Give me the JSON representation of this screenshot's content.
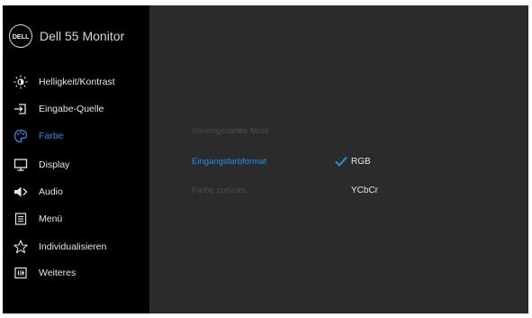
{
  "header": {
    "logo_text": "DELL",
    "model": "Dell 55 Monitor"
  },
  "menu": {
    "items": [
      {
        "label": "Helligkeit/Kontrast",
        "icon": "brightness-icon"
      },
      {
        "label": "Eingabe-Quelle",
        "icon": "input-source-icon"
      },
      {
        "label": "Farbe",
        "icon": "color-palette-icon",
        "active": true
      },
      {
        "label": "Display",
        "icon": "display-icon"
      },
      {
        "label": "Audio",
        "icon": "speaker-icon"
      },
      {
        "label": "Menü",
        "icon": "menu-icon"
      },
      {
        "label": "Individualisieren",
        "icon": "star-icon"
      },
      {
        "label": "Weiteres",
        "icon": "others-icon"
      }
    ]
  },
  "panel": {
    "preset_modes": "Voreingestellte Modi",
    "input_color_format": "Eingangsfarbformat",
    "reset_color": "Farbe zurücks.",
    "options": {
      "rgb": "RGB",
      "ycbcr": "YCbCr"
    },
    "selected_option": "RGB"
  },
  "colors": {
    "accent": "#1e90e8",
    "sidebar_bg": "#000000",
    "panel_bg": "#2b2b2b",
    "disabled_text": "#4d4d4d",
    "text": "#e6e6e6"
  }
}
